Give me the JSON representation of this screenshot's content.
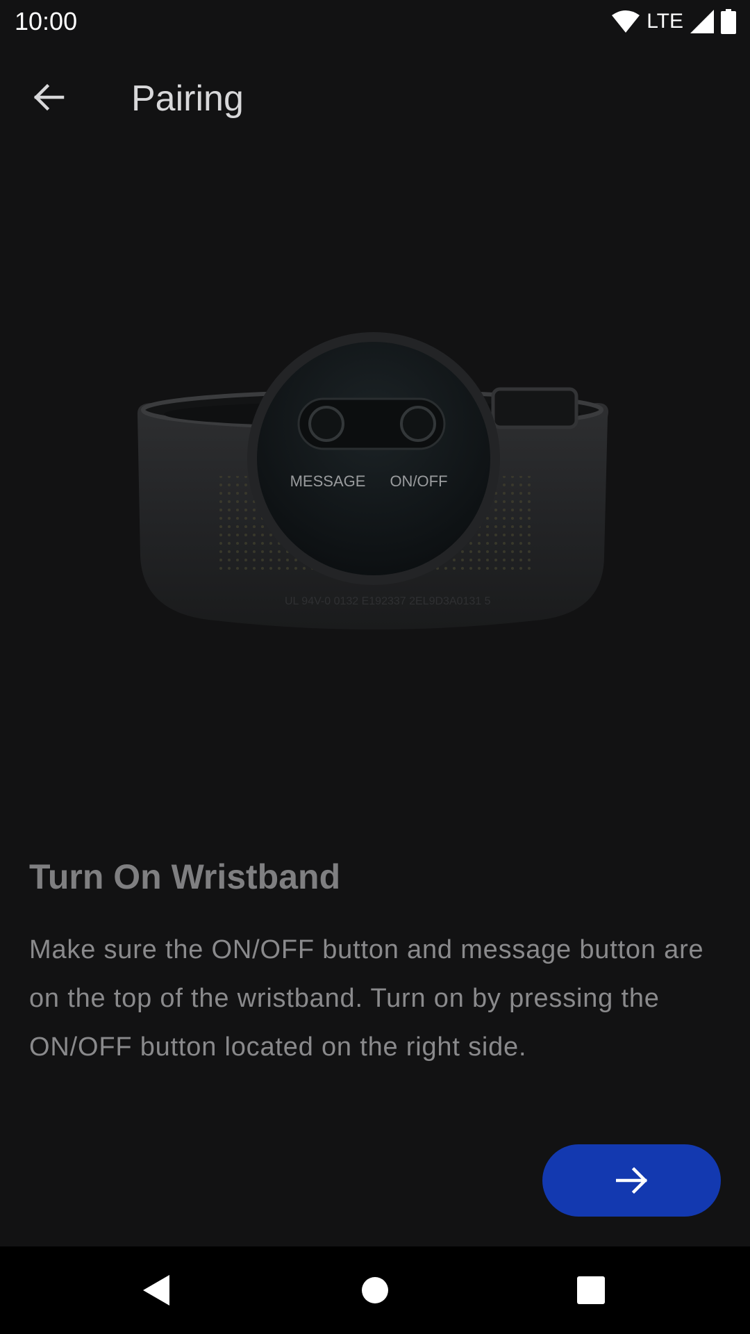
{
  "status_bar": {
    "time": "10:00",
    "network_label": "LTE",
    "icons": [
      "wifi-icon",
      "cellular-signal-icon",
      "battery-icon"
    ]
  },
  "app_bar": {
    "title": "Pairing",
    "back_icon": "arrow-left-icon"
  },
  "illustration": {
    "buttons": [
      "MESSAGE",
      "ON/OFF"
    ]
  },
  "content": {
    "heading": "Turn On Wristband",
    "description": "Make sure the ON/OFF button and message button are on the top of the wristband. Turn on by pressing the ON/OFF button located on the right side."
  },
  "next_button": {
    "icon": "arrow-right-icon",
    "color": "#1339b0"
  },
  "nav_bar": {
    "icons": [
      "nav-back-icon",
      "nav-home-icon",
      "nav-recents-icon"
    ]
  }
}
